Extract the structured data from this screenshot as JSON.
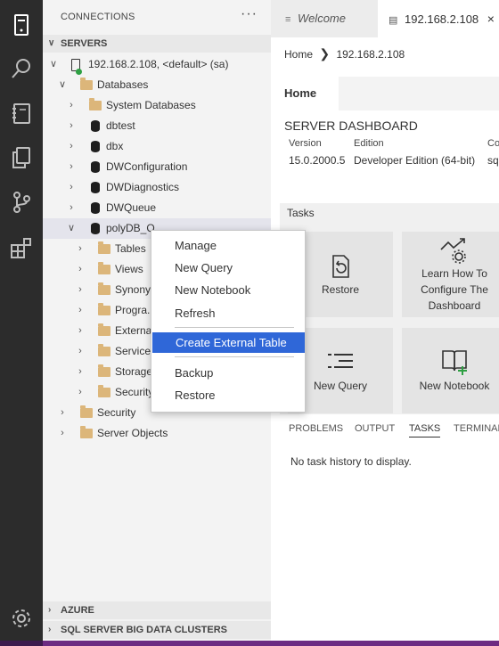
{
  "sidebar": {
    "title": "CONNECTIONS",
    "more": "···",
    "servers_header": "SERVERS",
    "azure_header": "AZURE",
    "bigdata_header": "SQL SERVER BIG DATA CLUSTERS",
    "tree": {
      "server": "192.168.2.108, <default> (sa)",
      "databases": "Databases",
      "system_databases": "System Databases",
      "dbtest": "dbtest",
      "dbx": "dbx",
      "dwconfiguration": "DWConfiguration",
      "dwdiagnostics": "DWDiagnostics",
      "dwqueue": "DWQueue",
      "polydb": "polyDB_Q...",
      "tables": "Tables",
      "views": "Views",
      "synonyms": "Synony...",
      "programmability": "Progra...",
      "external": "Externa...",
      "service": "Service...",
      "storage": "Storage...",
      "security_inner": "Security...",
      "security": "Security",
      "server_objects": "Server Objects"
    }
  },
  "tabs": {
    "welcome": "Welcome",
    "server": "192.168.2.108",
    "close": "×"
  },
  "breadcrumb": {
    "home": "Home",
    "separator": "❯",
    "server": "192.168.2.108"
  },
  "dashboard": {
    "subtab": "Home",
    "title": "SERVER DASHBOARD",
    "version_label": "Version",
    "version_value": "15.0.2000.5",
    "edition_label": "Edition",
    "edition_value": "Developer Edition (64-bit)",
    "col3_label": "Co",
    "col3_value": "sq",
    "tasks_header": "Tasks",
    "tasks": {
      "restore": "Restore",
      "learn_line1": "Learn How To",
      "learn_line2": "Configure The",
      "learn_line3": "Dashboard",
      "new_query": "New Query",
      "new_notebook": "New Notebook"
    }
  },
  "panel": {
    "problems": "PROBLEMS",
    "output": "OUTPUT",
    "tasks": "TASKS",
    "terminal": "TERMINAL",
    "empty": "No task history to display."
  },
  "context_menu": {
    "manage": "Manage",
    "new_query": "New Query",
    "new_notebook": "New Notebook",
    "refresh": "Refresh",
    "create_external_table": "Create External Table",
    "backup": "Backup",
    "restore": "Restore"
  },
  "colors": {
    "activity_bar": "#2c2c2c",
    "status_bar": "#6c2b82",
    "menu_selection": "#2f67d8",
    "folder": "#dcb67a",
    "connected": "#2ea043"
  }
}
